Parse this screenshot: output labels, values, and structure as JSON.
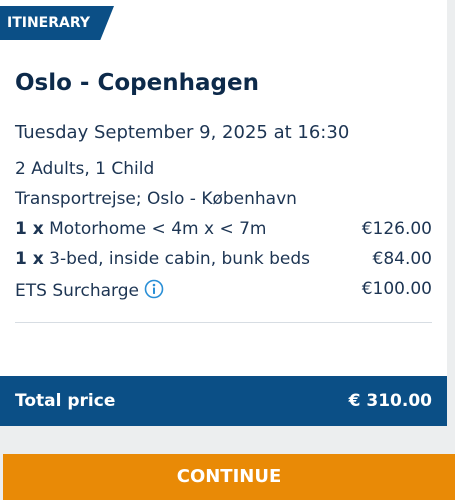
{
  "tag": {
    "label": "ITINERARY"
  },
  "route": {
    "title": "Oslo - Copenhagen"
  },
  "trip": {
    "date": "Tuesday September 9, 2025 at 16:30",
    "passengers": "2 Adults, 1 Child",
    "transport": "Transportrejse; Oslo - København"
  },
  "items": [
    {
      "qty": "1 x",
      "name": "Motorhome < 4m x < 7m",
      "price": "€126.00"
    },
    {
      "qty": "1 x",
      "name": "3-bed, inside cabin, bunk beds",
      "price": "€84.00"
    },
    {
      "name": "ETS Surcharge",
      "price": "€100.00",
      "icon": "info-icon"
    }
  ],
  "total": {
    "label": "Total price",
    "value": "€ 310.00"
  },
  "actions": {
    "continue_label": "CONTINUE"
  },
  "colors": {
    "brand_blue": "#0b4f86",
    "text_dark": "#0d2a4a",
    "accent_orange": "#e98a06",
    "background": "#eceeef"
  }
}
